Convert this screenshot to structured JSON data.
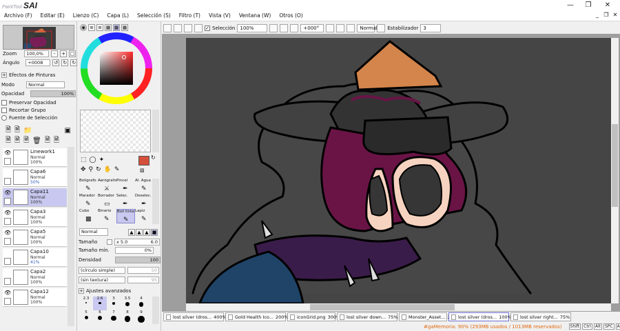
{
  "app": {
    "logo_small": "PaintTool",
    "logo_big": "SAI"
  },
  "menu": [
    "Archivo (F)",
    "Editar (E)",
    "Lienzo (C)",
    "Capa (L)",
    "Selección (S)",
    "Filtro (T)",
    "Vista (V)",
    "Ventana (W)",
    "Otros (O)"
  ],
  "toolbar": {
    "selection_label": "Selección",
    "zoom": "100%",
    "angle": "+000°",
    "blend": "Normal",
    "stabilizer_label": "Estabilizador",
    "stabilizer_value": "3"
  },
  "navigator": {
    "zoom_label": "Zoom",
    "zoom_value": "100,0%",
    "angle_label": "Ángulo",
    "angle_value": "+0008"
  },
  "layer_panel": {
    "effects_label": "Efectos de Pinturas",
    "mode_label": "Modo",
    "mode_value": "Normal",
    "opacity_label": "Opacidad",
    "opacity_value": "100%",
    "preserve_opacity": "Preservar Opacidad",
    "clip_group": "Recortar Grupo",
    "selection_source": "Fuente de Selección",
    "layers": [
      {
        "name": "Linework1",
        "mode": "Normal",
        "opacity": "100%",
        "visible": true,
        "selected": false
      },
      {
        "name": "Capa6",
        "mode": "Normal",
        "opacity": "50%",
        "visible": false,
        "selected": false
      },
      {
        "name": "Capa11",
        "mode": "Normal",
        "opacity": "100%",
        "visible": true,
        "selected": true
      },
      {
        "name": "Capa3",
        "mode": "Normal",
        "opacity": "100%",
        "visible": true,
        "selected": false
      },
      {
        "name": "Capa5",
        "mode": "Normal",
        "opacity": "100%",
        "visible": true,
        "selected": false
      },
      {
        "name": "Capa10",
        "mode": "Normal",
        "opacity": "41%",
        "visible": false,
        "selected": false
      },
      {
        "name": "Capa2",
        "mode": "Normal",
        "opacity": "100%",
        "visible": false,
        "selected": false
      },
      {
        "name": "Capa12",
        "mode": "Normal",
        "opacity": "100%",
        "visible": true,
        "selected": false
      }
    ]
  },
  "tools": {
    "items": [
      {
        "label": "Bolígrafo",
        "icon": "pen-icon"
      },
      {
        "label": "Aerógrafo",
        "icon": "airbrush-icon"
      },
      {
        "label": "Pincel",
        "icon": "brush-icon"
      },
      {
        "label": "Al. Agua",
        "icon": "watercolor-icon"
      },
      {
        "label": "Marador",
        "icon": "marker-icon"
      },
      {
        "label": "Borrador",
        "icon": "eraser-icon"
      },
      {
        "label": "Selec.",
        "icon": "select-brush-icon"
      },
      {
        "label": "Deselec.",
        "icon": "deselect-brush-icon"
      },
      {
        "label": "Cubo",
        "icon": "bucket-icon"
      },
      {
        "label": "Binario",
        "icon": "binary-pen-icon"
      },
      {
        "label": "Boli tinta",
        "icon": "ink-pen-icon",
        "selected": true
      },
      {
        "label": "Lapiz",
        "icon": "pencil-icon"
      }
    ],
    "brush_mode": "Normal",
    "size_label": "Tamaño",
    "size_mult": "x 5.0",
    "size_value": "6.0",
    "min_size_label": "Tamaño mín.",
    "min_size_value": "0%",
    "density_label": "Densidad",
    "density_value": "100",
    "shape": "(círculo simple)",
    "shape_value": "50",
    "texture": "(sin textura)",
    "texture_value": "95",
    "advanced_label": "Ajustes avanzados",
    "brush_sizes_row1": [
      "2.3",
      "2.6",
      "3",
      "3.5",
      "4"
    ],
    "brush_sizes_row2": [
      "5",
      "6",
      "7",
      "8",
      "9"
    ],
    "primary_color": "#d4503a"
  },
  "tabs": [
    {
      "name": "lost silver (dros...",
      "pct": "400%"
    },
    {
      "name": "Gold Health Ico...",
      "pct": "200%"
    },
    {
      "name": "iconGrid.png",
      "pct": "300%"
    },
    {
      "name": "lost silver down...",
      "pct": "75%"
    },
    {
      "name": "Monster_Asset...",
      "pct": "200%"
    },
    {
      "name": "lost silver (dros...",
      "pct": "100%",
      "active": true
    },
    {
      "name": "lost silver right...",
      "pct": "75%"
    }
  ],
  "status": {
    "memory": "#gaMemoria: 90% (293MB usados / 1013MB reservados)",
    "keys": [
      "Shift",
      "Ctrl",
      "Alt",
      "SPC",
      "Any"
    ]
  }
}
